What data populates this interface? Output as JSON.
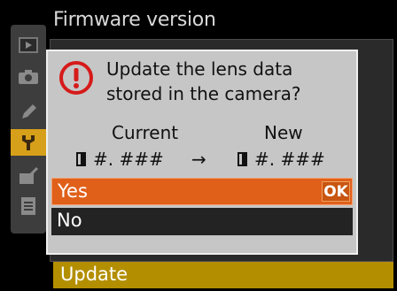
{
  "title": "Firmware version",
  "dialog": {
    "message_line1": "Update the lens data",
    "message_line2": "stored in the camera?",
    "current_label": "Current",
    "new_label": "New",
    "current_version": "#. ###",
    "new_version": "#. ###",
    "arrow": "→",
    "options": {
      "yes": "Yes",
      "no": "No",
      "ok_badge": "OK"
    }
  },
  "background_menu": {
    "selected_item": "Update"
  },
  "sidebar": {
    "items": [
      "playback-icon",
      "camera-icon",
      "pencil-icon",
      "wrench-icon",
      "retouch-icon",
      "menu-icon"
    ],
    "active_item": "wrench-icon"
  },
  "colors": {
    "dialog_bg": "#c6c6c6",
    "selected_option": "#e0601a",
    "menu_highlight": "#b38f00",
    "warning": "#d61a1a"
  }
}
